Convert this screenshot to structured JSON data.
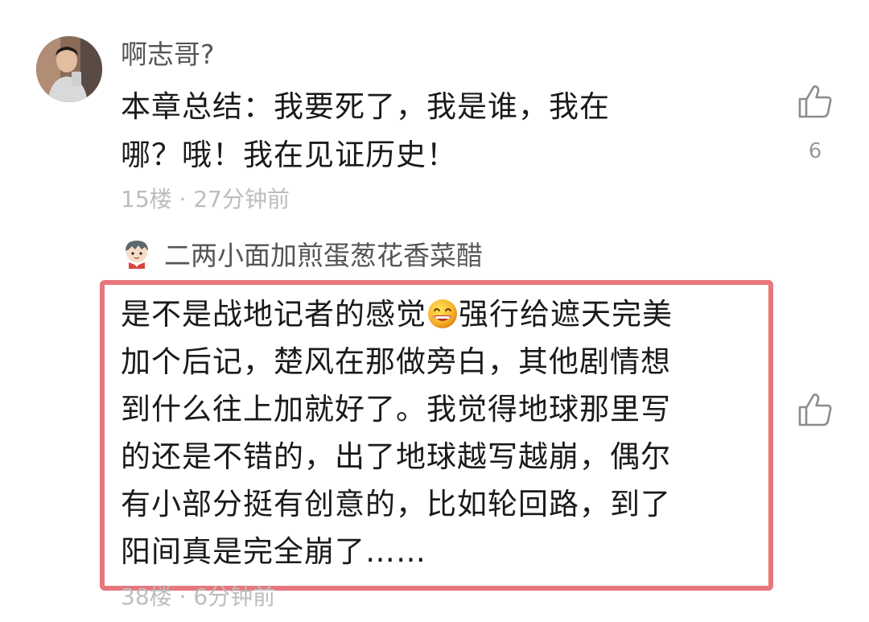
{
  "comments": [
    {
      "username": "啊志哥?",
      "text_lines": [
        "本章总结：我要死了，我是谁，我在",
        "哪？哦！我在见证历史！"
      ],
      "meta": "15楼 · 27分钟前",
      "like_count": "6",
      "avatar_icon": "user-photo-avatar"
    }
  ],
  "reply": {
    "username": "二两小面加煎蛋葱花香菜醋",
    "avatar_icon": "cartoon-boy-avatar",
    "text_line1_pre": "是不是战地记者的感觉",
    "text_line1_post": "强行给遮天完美",
    "text_lines": [
      "加个后记，楚风在那做旁白，其他剧情想",
      "到什么往上加就好了。我觉得地球那里写",
      "的还是不错的，出了地球越写越崩，偶尔",
      "有小部分挺有创意的，比如轮回路，到了",
      "阳间真是完全崩了……"
    ],
    "meta": "38楼 · 6分钟前",
    "emoji_icon": "grinning-face-emoji",
    "highlight_color": "#e8777d"
  }
}
